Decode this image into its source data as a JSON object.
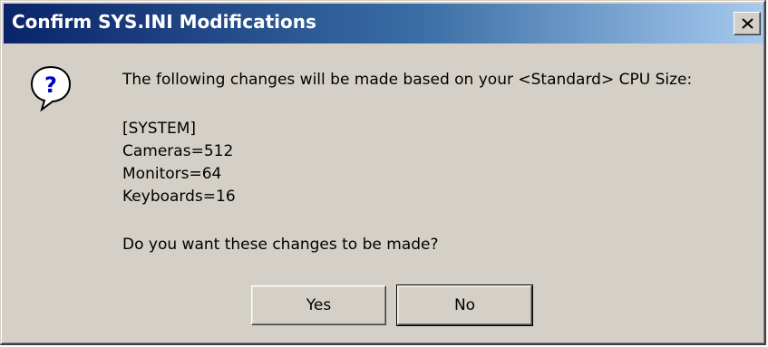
{
  "window": {
    "title": "Confirm SYS.INI Modifications",
    "close_symbol": "✕"
  },
  "icon": {
    "name": "question-icon",
    "glyph": "?"
  },
  "message": {
    "intro": "The following changes will be made based on your <Standard> CPU Size:",
    "section": "[SYSTEM]",
    "settings": [
      "Cameras=512",
      "Monitors=64",
      "Keyboards=16"
    ],
    "question": "Do you want these changes to be made?"
  },
  "buttons": {
    "yes_label": "Yes",
    "no_label": "No"
  }
}
